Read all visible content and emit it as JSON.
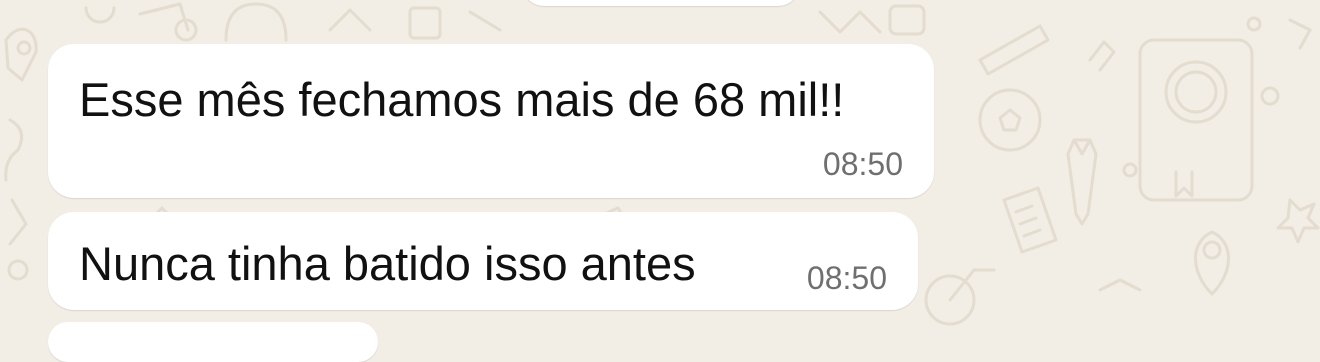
{
  "colors": {
    "chat_background": "#f2ede5",
    "doodle_stroke": "#e3dccf",
    "bubble_incoming": "#ffffff",
    "message_text": "#111111",
    "timestamp_text": "#6f6f6f"
  },
  "wallpaper": {
    "icon_names": [
      "rocket-icon",
      "star-badge-icon",
      "necktie-icon",
      "receipt-icon",
      "pound-coin-book-icon",
      "location-pin-icon",
      "bicycle-icon",
      "pencil-icon"
    ]
  },
  "messages": [
    {
      "text": "Esse mês fechamos mais de 68 mil!!",
      "time": "08:50"
    },
    {
      "text": "Nunca tinha batido isso antes",
      "time": "08:50"
    }
  ]
}
